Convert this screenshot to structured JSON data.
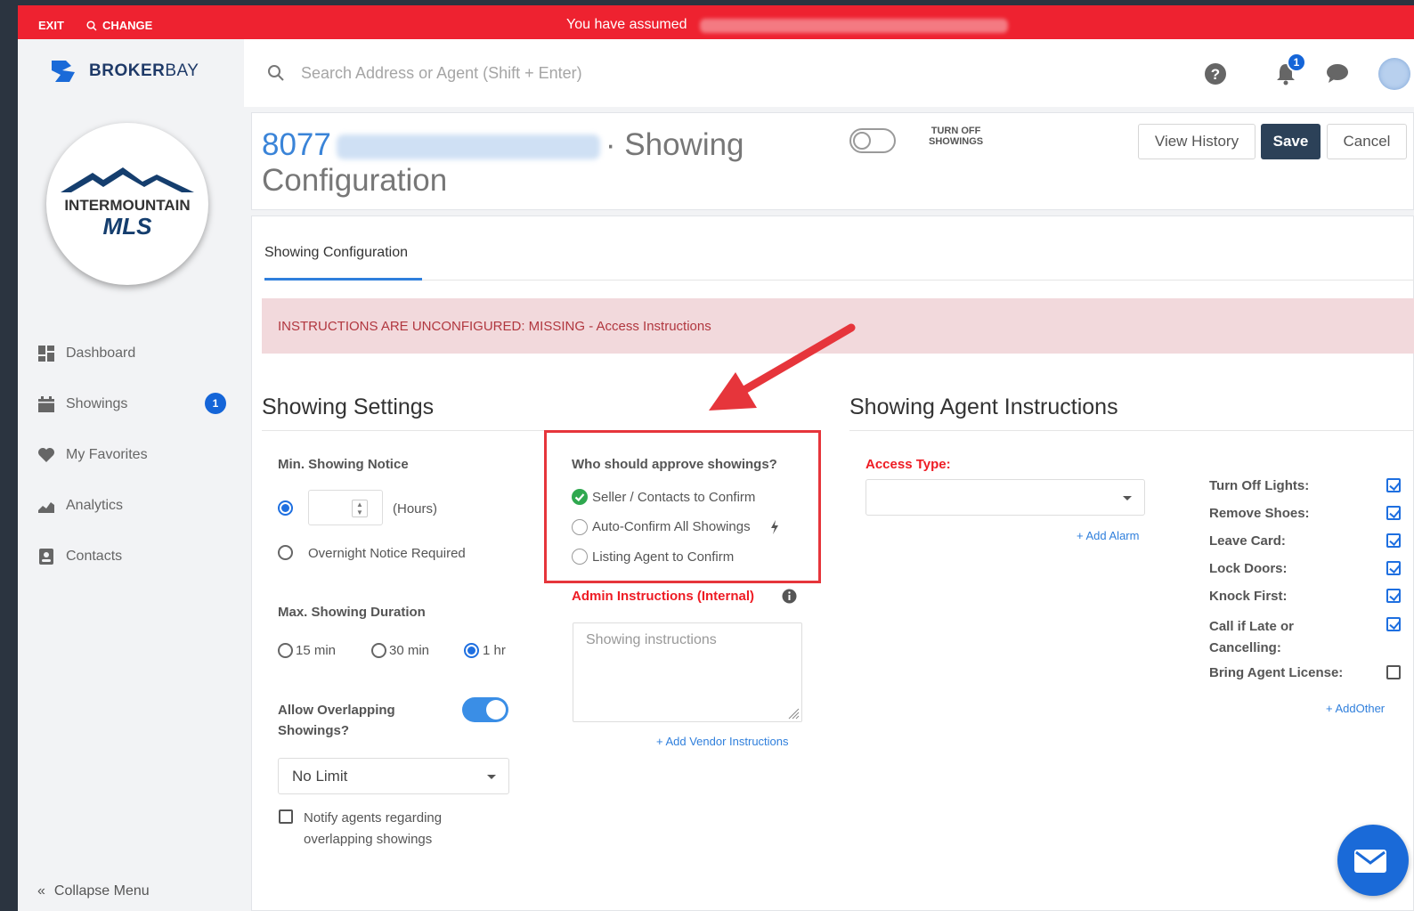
{
  "assume_bar": {
    "exit": "EXIT",
    "change": "CHANGE",
    "assumed_text": "You have assumed"
  },
  "brand": {
    "name_bold": "BROKER",
    "name_light": "BAY"
  },
  "mls_logo": {
    "line1": "INTERMOUNTAIN",
    "line2": "MLS"
  },
  "sidebar": {
    "items": [
      {
        "label": "Dashboard",
        "icon": "dashboard-icon"
      },
      {
        "label": "Showings",
        "icon": "calendar-icon",
        "badge": "1"
      },
      {
        "label": "My Favorites",
        "icon": "heart-icon"
      },
      {
        "label": "Analytics",
        "icon": "area-chart-icon"
      },
      {
        "label": "Contacts",
        "icon": "contact-card-icon"
      }
    ],
    "collapse": "Collapse Menu"
  },
  "header": {
    "search_placeholder": "Search Address or Agent (Shift + Enter)",
    "notification_count": "1"
  },
  "title_card": {
    "number": "8077",
    "title_rest": "Showing",
    "title_line2": "Configuration",
    "turn_off_label_1": "TURN OFF",
    "turn_off_label_2": "SHOWINGS",
    "view_history": "View History",
    "save": "Save",
    "cancel": "Cancel"
  },
  "tab": "Showing Configuration",
  "alert": "INSTRUCTIONS ARE UNCONFIGURED: MISSING - Access Instructions",
  "showing_settings": {
    "title": "Showing Settings",
    "min_notice_label": "Min. Showing Notice",
    "hours_label": "(Hours)",
    "overnight_label": "Overnight Notice Required",
    "max_duration_label": "Max. Showing Duration",
    "duration_options": [
      "15 min",
      "30 min",
      "1 hr"
    ],
    "duration_selected": "1 hr",
    "overlap_label_1": "Allow Overlapping",
    "overlap_label_2": "Showings?",
    "overlap_enabled": true,
    "limit_value": "No Limit",
    "notify_label_1": "Notify agents regarding",
    "notify_label_2": "overlapping showings"
  },
  "approval": {
    "question": "Who should approve showings?",
    "options": [
      "Seller / Contacts to Confirm",
      "Auto-Confirm All Showings",
      "Listing Agent to Confirm"
    ],
    "selected": "Seller / Contacts to Confirm",
    "admin_label": "Admin Instructions (Internal)",
    "admin_placeholder": "Showing instructions",
    "add_vendor": "+ Add Vendor Instructions"
  },
  "agent_instructions": {
    "title": "Showing Agent Instructions",
    "access_type_label": "Access Type:",
    "add_alarm": "+ Add Alarm",
    "items": [
      {
        "label": "Turn Off Lights:",
        "checked": true
      },
      {
        "label": "Remove Shoes:",
        "checked": true
      },
      {
        "label": "Leave Card:",
        "checked": true
      },
      {
        "label": "Lock Doors:",
        "checked": true
      },
      {
        "label": "Knock First:",
        "checked": true
      },
      {
        "label": "Call if Late or",
        "label2": "Cancelling:",
        "checked": true
      },
      {
        "label": "Bring Agent License:",
        "checked": false
      }
    ],
    "add_other": "+ AddOther"
  },
  "colors": {
    "assume_bar": "#ee2230",
    "primary_blue": "#1e6fe0",
    "save_button": "#2c4158",
    "alert_bg": "#f2d9dc",
    "highlight_red": "#e6353b"
  }
}
